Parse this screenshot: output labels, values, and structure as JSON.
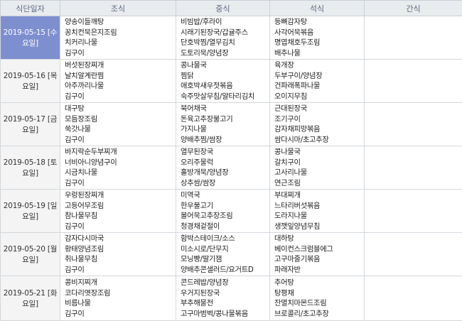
{
  "headers": [
    "식단일자",
    "조식",
    "중식",
    "석식",
    "간식"
  ],
  "selected_index": 0,
  "days": [
    {
      "date": "2019-05-15 [수요일]",
      "breakfast": [
        "양송이들깨탕",
        "꽁치컨묵은지조림",
        "치커리나물",
        "김구이"
      ],
      "lunch": [
        "비빔밥/후라이",
        "시래기된장국/갑귤주스",
        "단호박찜/열무김치",
        "도토리묵/양념장"
      ],
      "dinner": [
        "등뼈감자탕",
        "사각어묵볶음",
        "명엽채호두조림",
        "배추나물"
      ],
      "snack": []
    },
    {
      "date": "2019-05-16 [목요일]",
      "breakfast": [
        "버섯된장찌개",
        "날치알계란찜",
        "아주까리나물",
        "김구이"
      ],
      "lunch": [
        "콩나물국",
        "찜닭",
        "애호박새우젓볶음",
        "숙주맛살무침/알타리김치"
      ],
      "dinner": [
        "육개장",
        "두부구이/양념장",
        "건파래폭파나물",
        "오이지무침"
      ],
      "snack": []
    },
    {
      "date": "2019-05-17 [금요일]",
      "breakfast": [
        "대구탕",
        "모듬장조림",
        "쑥갓나물",
        "김구이"
      ],
      "lunch": [
        "북어채국",
        "돈육고추장불고기",
        "가지나물",
        "양배추찜/쌈장"
      ],
      "dinner": [
        "근대된장국",
        "조기구이",
        "감자채피망볶음",
        "쌈다시마/초고추장"
      ],
      "snack": []
    },
    {
      "date": "2019-05-18 [토요일]",
      "breakfast": [
        "바지락순두부찌개",
        "너비아니양념구이",
        "시금치나물",
        "김구이"
      ],
      "lunch": [
        "열무된장국",
        "오리주물럭",
        "홀방개묵/양념장",
        "상추쌈/쌈장"
      ],
      "dinner": [
        "콩나물국",
        "갈치구이",
        "고사리나물",
        "연근조림"
      ],
      "snack": []
    },
    {
      "date": "2019-05-19 [일요일]",
      "breakfast": [
        "우렁된장찌개",
        "고등어무조림",
        "참나물무침",
        "김구이"
      ],
      "lunch": [
        "미역국",
        "한우불고기",
        "볼어묵고추장조림",
        "청경채겉절이"
      ],
      "dinner": [
        "부대찌개",
        "느타리버섯볶음",
        "도라지나물",
        "생깻잎양념무침"
      ],
      "snack": []
    },
    {
      "date": "2019-05-20 [월요일]",
      "breakfast": [
        "감자다시마국",
        "황태양념조림",
        "취나물무침",
        "김구이"
      ],
      "lunch": [
        "함박스테이크/소스",
        "미소시로/단무지",
        "모닝빵/딸기잼",
        "양배추콘샐러드/요거트D"
      ],
      "dinner": [
        "대하탕",
        "베이컨스크럼블에그",
        "고구마줄기볶음",
        "파래자반"
      ],
      "snack": []
    },
    {
      "date": "2019-05-21 [화요일]",
      "breakfast": [
        "콩비지찌개",
        "코다리엿장조림",
        "비름나물",
        "김구이"
      ],
      "lunch": [
        "콘드레밥/양념장",
        "우거지된장국",
        "부추해물전",
        "고구마범벅/콩나물볶음"
      ],
      "dinner": [
        "추어탕",
        "탕평채",
        "잔멸치마몬드조림",
        "브로콜리/초고추장"
      ],
      "snack": []
    }
  ]
}
